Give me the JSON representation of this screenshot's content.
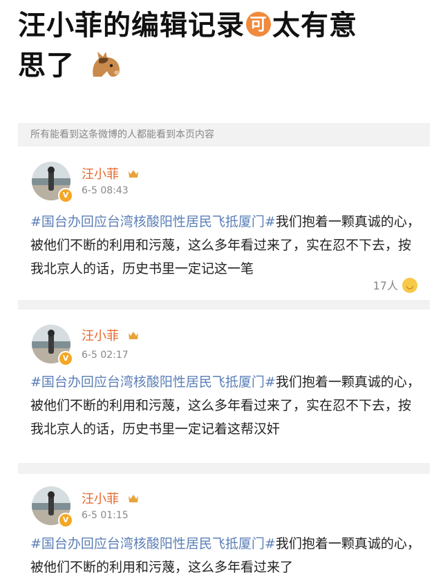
{
  "headline": {
    "line1": "汪小菲的编辑记录",
    "badge": "可",
    "line1_tail": "太有意",
    "line2": "思了"
  },
  "notice": "所有能看到这条微博的人都能看到本页内容",
  "posts": [
    {
      "username": "汪小菲",
      "time": "6-5 08:43",
      "hashtag": "#国台办回应台湾核酸阳性居民飞抵厦门#",
      "text": "我们抱着一颗真诚的心，被他们不断的利用和污蔑，这么多年看过来了，实在忍不下去，按我北京人的话，历史书里一定记这一笔",
      "likes": "17人"
    },
    {
      "username": "汪小菲",
      "time": "6-5 02:17",
      "hashtag": "#国台办回应台湾核酸阳性居民飞抵厦门#",
      "text": "我们抱着一颗真诚的心，被他们不断的利用和污蔑，这么多年看过来了，实在忍不下去，按我北京人的话，历史书里一定记着这帮汉奸"
    },
    {
      "username": "汪小菲",
      "time": "6-5 01:15",
      "hashtag": "#国台办回应台湾核酸阳性居民飞抵厦门#",
      "text": "我们抱着一颗真诚的心，被他们不断的利用和污蔑，这么多年看过来了"
    }
  ],
  "icons": {
    "vip": "vip-crown-icon",
    "verified": "verified-badge-icon",
    "laugh": "laugh-emoji-icon",
    "horse": "horse-emoji-icon"
  },
  "colors": {
    "username": "#e8662a",
    "hashtag": "#5b7fb7",
    "badge": "#f08a3c"
  }
}
